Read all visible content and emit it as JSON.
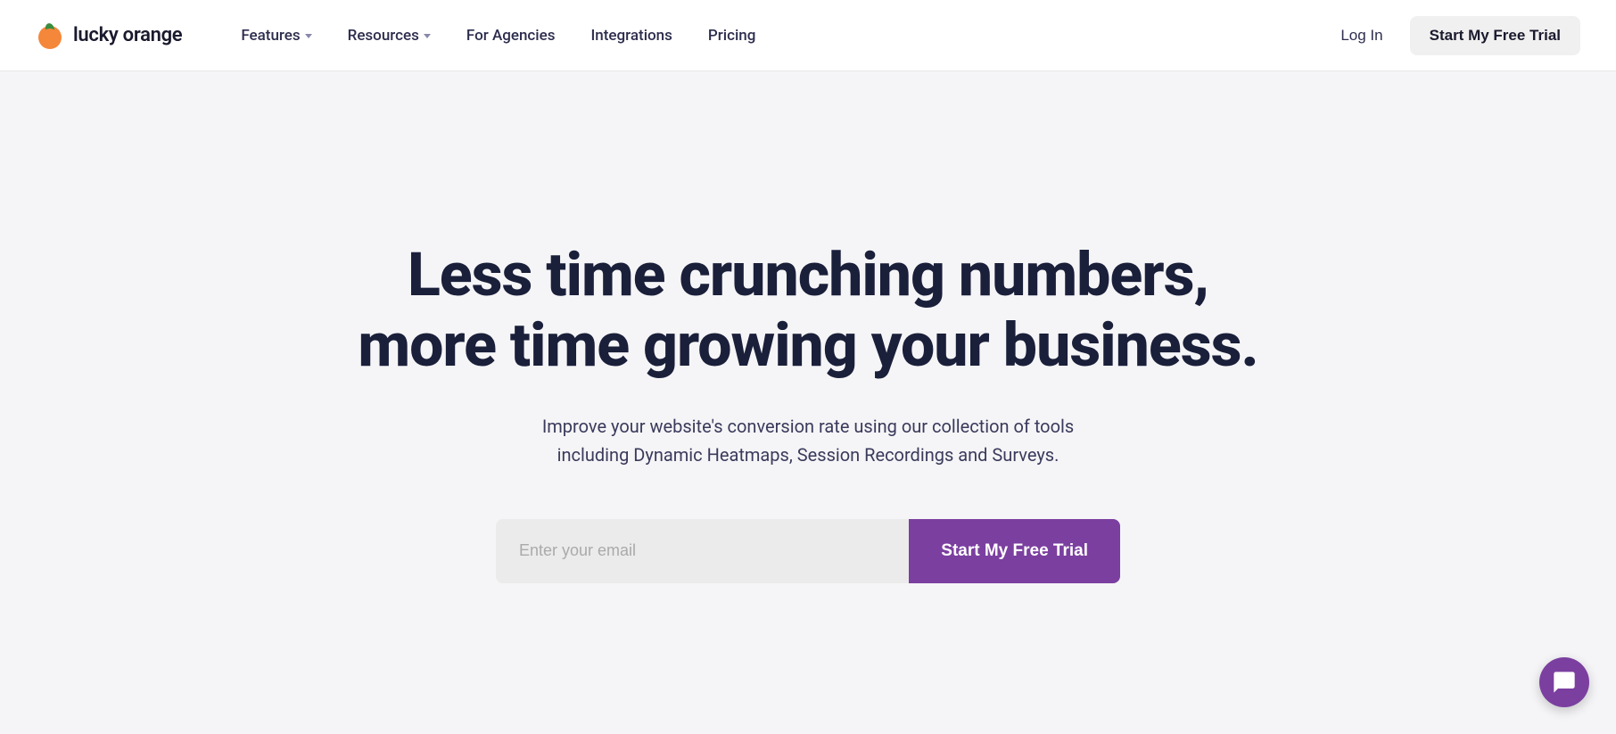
{
  "brand": {
    "name": "lucky orange",
    "logo_alt": "Lucky Orange logo"
  },
  "navbar": {
    "features_label": "Features",
    "resources_label": "Resources",
    "for_agencies_label": "For Agencies",
    "integrations_label": "Integrations",
    "pricing_label": "Pricing",
    "login_label": "Log In",
    "trial_label": "Start My Free Trial"
  },
  "hero": {
    "headline_line1": "Less time crunching numbers,",
    "headline_line2": "more time growing your business.",
    "subtext": "Improve your website's conversion rate using our collection of tools including Dynamic Heatmaps, Session Recordings and Surveys.",
    "email_placeholder": "Enter your email",
    "trial_label": "Start My Free Trial"
  },
  "colors": {
    "brand_purple": "#7b3fa0",
    "nav_bg": "#ffffff",
    "hero_bg": "#f5f5f7",
    "headline": "#1a1f3a",
    "subtext": "#3a3a5c"
  }
}
